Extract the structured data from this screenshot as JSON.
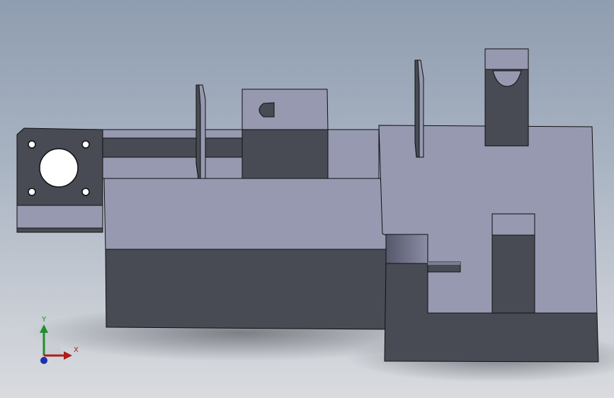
{
  "viewport": {
    "background_top": "#8f9db0",
    "background_bottom": "#d9dbdf"
  },
  "model": {
    "face_light": "#9699b0",
    "face_dark": "#484b54",
    "edge": "#101010"
  },
  "triad": {
    "y_label": "Y",
    "x_label": "X",
    "y_color": "#1f8f2a",
    "x_color": "#b01c1c",
    "z_color": "#1c2fb0"
  }
}
